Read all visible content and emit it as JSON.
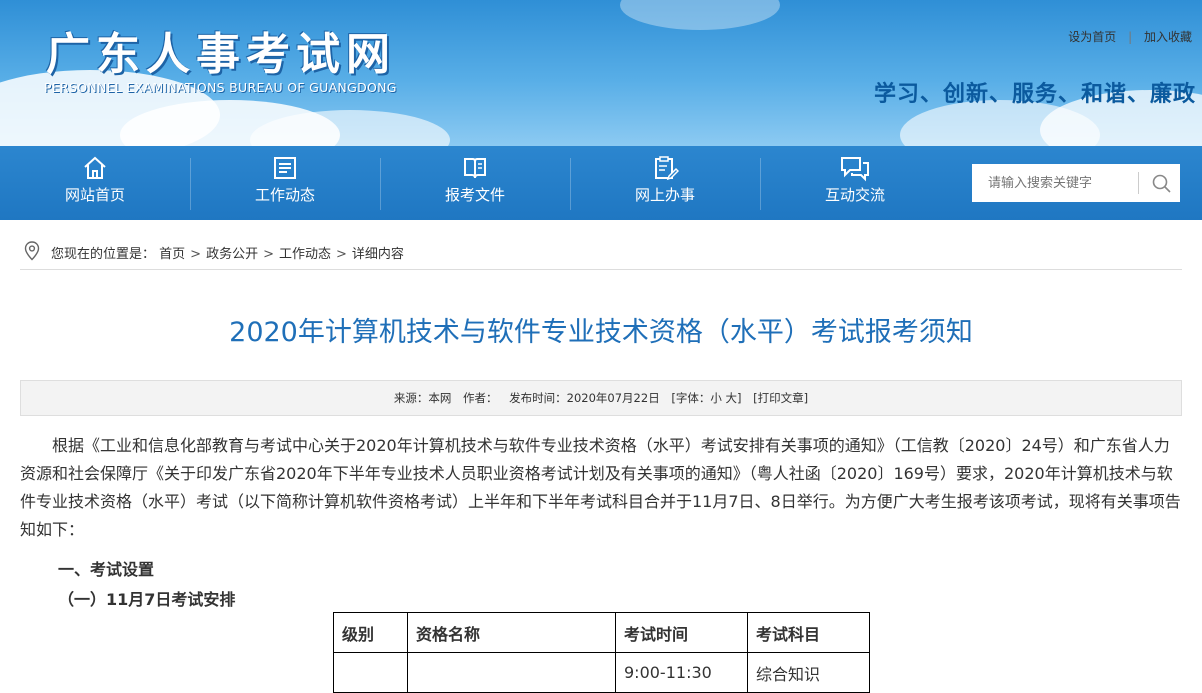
{
  "header": {
    "logo_cn": "广东人事考试网",
    "logo_en": "PERSONNEL EXAMINATIONS BUREAU OF GUANGDONG",
    "links": {
      "homepage": "设为首页",
      "separator": "|",
      "favorite": "加入收藏"
    },
    "slogan": "学习、创新、服务、和谐、廉政"
  },
  "nav": {
    "items": [
      {
        "label": "网站首页",
        "icon": "home-icon"
      },
      {
        "label": "工作动态",
        "icon": "list-icon"
      },
      {
        "label": "报考文件",
        "icon": "book-icon"
      },
      {
        "label": "网上办事",
        "icon": "clipboard-edit-icon"
      },
      {
        "label": "互动交流",
        "icon": "chat-icon"
      }
    ],
    "search_placeholder": "请输入搜索关键字"
  },
  "breadcrumb": {
    "prefix": "您现在的位置是：",
    "items": [
      "首页",
      "政务公开",
      "工作动态",
      "详细内容"
    ],
    "separator": ">"
  },
  "article": {
    "title": "2020年计算机技术与软件专业技术资格（水平）考试报考须知",
    "meta": {
      "source": "来源：本网",
      "author": "作者：",
      "date": "发布时间：2020年07月22日",
      "font": "[字体：小 大]",
      "print": "[打印文章]"
    },
    "intro": "根据《工业和信息化部教育与考试中心关于2020年计算机技术与软件专业技术资格（水平）考试安排有关事项的通知》（工信教〔2020〕24号）和广东省人力资源和社会保障厅《关于印发广东省2020年下半年专业技术人员职业资格考试计划及有关事项的通知》（粤人社函〔2020〕169号）要求，2020年计算机技术与软件专业技术资格（水平）考试（以下简称计算机软件资格考试）上半年和下半年考试科目合并于11月7日、8日举行。为方便广大考生报考该项考试，现将有关事项告知如下：",
    "section1": "一、考试设置",
    "section1_1": "（一）11月7日考试安排",
    "table": {
      "headers": [
        "级别",
        "资格名称",
        "考试时间",
        "考试科目"
      ],
      "rows": [
        [
          "",
          "",
          "9:00-11:30",
          "综合知识"
        ]
      ]
    }
  }
}
